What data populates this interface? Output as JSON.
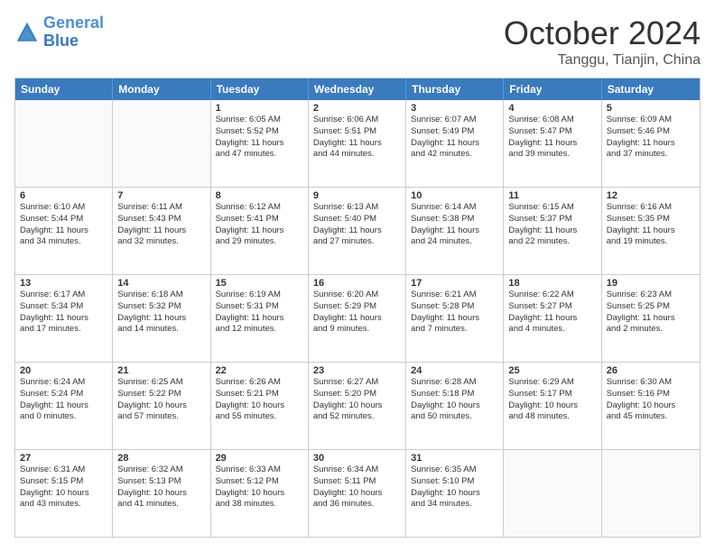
{
  "header": {
    "logo_line1": "General",
    "logo_line2": "Blue",
    "month": "October 2024",
    "location": "Tanggu, Tianjin, China"
  },
  "days_of_week": [
    "Sunday",
    "Monday",
    "Tuesday",
    "Wednesday",
    "Thursday",
    "Friday",
    "Saturday"
  ],
  "weeks": [
    [
      {
        "day": "",
        "lines": [],
        "empty": true
      },
      {
        "day": "",
        "lines": [],
        "empty": true
      },
      {
        "day": "1",
        "lines": [
          "Sunrise: 6:05 AM",
          "Sunset: 5:52 PM",
          "Daylight: 11 hours",
          "and 47 minutes."
        ]
      },
      {
        "day": "2",
        "lines": [
          "Sunrise: 6:06 AM",
          "Sunset: 5:51 PM",
          "Daylight: 11 hours",
          "and 44 minutes."
        ]
      },
      {
        "day": "3",
        "lines": [
          "Sunrise: 6:07 AM",
          "Sunset: 5:49 PM",
          "Daylight: 11 hours",
          "and 42 minutes."
        ]
      },
      {
        "day": "4",
        "lines": [
          "Sunrise: 6:08 AM",
          "Sunset: 5:47 PM",
          "Daylight: 11 hours",
          "and 39 minutes."
        ]
      },
      {
        "day": "5",
        "lines": [
          "Sunrise: 6:09 AM",
          "Sunset: 5:46 PM",
          "Daylight: 11 hours",
          "and 37 minutes."
        ]
      }
    ],
    [
      {
        "day": "6",
        "lines": [
          "Sunrise: 6:10 AM",
          "Sunset: 5:44 PM",
          "Daylight: 11 hours",
          "and 34 minutes."
        ]
      },
      {
        "day": "7",
        "lines": [
          "Sunrise: 6:11 AM",
          "Sunset: 5:43 PM",
          "Daylight: 11 hours",
          "and 32 minutes."
        ]
      },
      {
        "day": "8",
        "lines": [
          "Sunrise: 6:12 AM",
          "Sunset: 5:41 PM",
          "Daylight: 11 hours",
          "and 29 minutes."
        ]
      },
      {
        "day": "9",
        "lines": [
          "Sunrise: 6:13 AM",
          "Sunset: 5:40 PM",
          "Daylight: 11 hours",
          "and 27 minutes."
        ]
      },
      {
        "day": "10",
        "lines": [
          "Sunrise: 6:14 AM",
          "Sunset: 5:38 PM",
          "Daylight: 11 hours",
          "and 24 minutes."
        ]
      },
      {
        "day": "11",
        "lines": [
          "Sunrise: 6:15 AM",
          "Sunset: 5:37 PM",
          "Daylight: 11 hours",
          "and 22 minutes."
        ]
      },
      {
        "day": "12",
        "lines": [
          "Sunrise: 6:16 AM",
          "Sunset: 5:35 PM",
          "Daylight: 11 hours",
          "and 19 minutes."
        ]
      }
    ],
    [
      {
        "day": "13",
        "lines": [
          "Sunrise: 6:17 AM",
          "Sunset: 5:34 PM",
          "Daylight: 11 hours",
          "and 17 minutes."
        ]
      },
      {
        "day": "14",
        "lines": [
          "Sunrise: 6:18 AM",
          "Sunset: 5:32 PM",
          "Daylight: 11 hours",
          "and 14 minutes."
        ]
      },
      {
        "day": "15",
        "lines": [
          "Sunrise: 6:19 AM",
          "Sunset: 5:31 PM",
          "Daylight: 11 hours",
          "and 12 minutes."
        ]
      },
      {
        "day": "16",
        "lines": [
          "Sunrise: 6:20 AM",
          "Sunset: 5:29 PM",
          "Daylight: 11 hours",
          "and 9 minutes."
        ]
      },
      {
        "day": "17",
        "lines": [
          "Sunrise: 6:21 AM",
          "Sunset: 5:28 PM",
          "Daylight: 11 hours",
          "and 7 minutes."
        ]
      },
      {
        "day": "18",
        "lines": [
          "Sunrise: 6:22 AM",
          "Sunset: 5:27 PM",
          "Daylight: 11 hours",
          "and 4 minutes."
        ]
      },
      {
        "day": "19",
        "lines": [
          "Sunrise: 6:23 AM",
          "Sunset: 5:25 PM",
          "Daylight: 11 hours",
          "and 2 minutes."
        ]
      }
    ],
    [
      {
        "day": "20",
        "lines": [
          "Sunrise: 6:24 AM",
          "Sunset: 5:24 PM",
          "Daylight: 11 hours",
          "and 0 minutes."
        ]
      },
      {
        "day": "21",
        "lines": [
          "Sunrise: 6:25 AM",
          "Sunset: 5:22 PM",
          "Daylight: 10 hours",
          "and 57 minutes."
        ]
      },
      {
        "day": "22",
        "lines": [
          "Sunrise: 6:26 AM",
          "Sunset: 5:21 PM",
          "Daylight: 10 hours",
          "and 55 minutes."
        ]
      },
      {
        "day": "23",
        "lines": [
          "Sunrise: 6:27 AM",
          "Sunset: 5:20 PM",
          "Daylight: 10 hours",
          "and 52 minutes."
        ]
      },
      {
        "day": "24",
        "lines": [
          "Sunrise: 6:28 AM",
          "Sunset: 5:18 PM",
          "Daylight: 10 hours",
          "and 50 minutes."
        ]
      },
      {
        "day": "25",
        "lines": [
          "Sunrise: 6:29 AM",
          "Sunset: 5:17 PM",
          "Daylight: 10 hours",
          "and 48 minutes."
        ]
      },
      {
        "day": "26",
        "lines": [
          "Sunrise: 6:30 AM",
          "Sunset: 5:16 PM",
          "Daylight: 10 hours",
          "and 45 minutes."
        ]
      }
    ],
    [
      {
        "day": "27",
        "lines": [
          "Sunrise: 6:31 AM",
          "Sunset: 5:15 PM",
          "Daylight: 10 hours",
          "and 43 minutes."
        ]
      },
      {
        "day": "28",
        "lines": [
          "Sunrise: 6:32 AM",
          "Sunset: 5:13 PM",
          "Daylight: 10 hours",
          "and 41 minutes."
        ]
      },
      {
        "day": "29",
        "lines": [
          "Sunrise: 6:33 AM",
          "Sunset: 5:12 PM",
          "Daylight: 10 hours",
          "and 38 minutes."
        ]
      },
      {
        "day": "30",
        "lines": [
          "Sunrise: 6:34 AM",
          "Sunset: 5:11 PM",
          "Daylight: 10 hours",
          "and 36 minutes."
        ]
      },
      {
        "day": "31",
        "lines": [
          "Sunrise: 6:35 AM",
          "Sunset: 5:10 PM",
          "Daylight: 10 hours",
          "and 34 minutes."
        ]
      },
      {
        "day": "",
        "lines": [],
        "empty": true
      },
      {
        "day": "",
        "lines": [],
        "empty": true
      }
    ]
  ]
}
